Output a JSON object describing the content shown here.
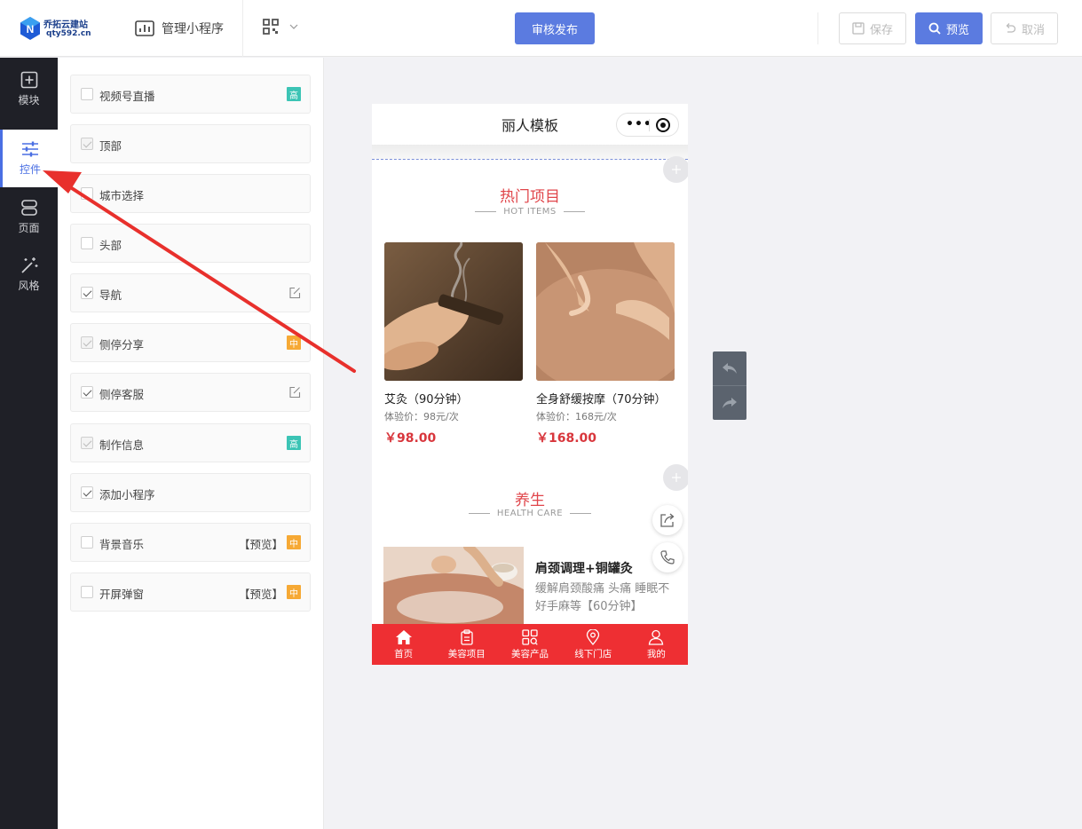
{
  "topbar": {
    "logo_text": "乔拓云建站",
    "logo_domain": "qty592.cn",
    "manage_label": "管理小程序",
    "publish_label": "审核发布",
    "save_label": "保存",
    "preview_label": "预览",
    "cancel_label": "取消"
  },
  "sidebar": {
    "items": [
      {
        "label": "模块",
        "icon": "plus-square-icon"
      },
      {
        "label": "控件",
        "icon": "sliders-icon",
        "active": true
      },
      {
        "label": "页面",
        "icon": "pages-icon"
      },
      {
        "label": "风格",
        "icon": "magic-wand-icon"
      }
    ]
  },
  "controls": {
    "preview_tag": "【预览】",
    "badge_high": "高",
    "badge_mid": "中",
    "items": [
      {
        "label": "视频号直播",
        "state": "unchecked",
        "badge": "高"
      },
      {
        "label": "顶部",
        "state": "checked-disabled"
      },
      {
        "label": "城市选择",
        "state": "unchecked"
      },
      {
        "label": "头部",
        "state": "unchecked"
      },
      {
        "label": "导航",
        "state": "checked",
        "edit": true
      },
      {
        "label": "侧停分享",
        "state": "checked-disabled",
        "badge": "中"
      },
      {
        "label": "侧停客服",
        "state": "checked",
        "edit": true
      },
      {
        "label": "制作信息",
        "state": "checked-disabled",
        "badge": "高"
      },
      {
        "label": "添加小程序",
        "state": "checked"
      },
      {
        "label": "背景音乐",
        "state": "unchecked",
        "preview": true,
        "badge": "中"
      },
      {
        "label": "开屏弹窗",
        "state": "unchecked",
        "preview": true,
        "badge": "中"
      }
    ]
  },
  "phone": {
    "title": "丽人模板",
    "hot": {
      "title": "热门项目",
      "subtitle": "HOT ITEMS",
      "products": [
        {
          "name": "艾灸（90分钟）",
          "exp": "体验价：98元/次",
          "price": "￥98.00"
        },
        {
          "name": "全身舒缓按摩（70分钟）",
          "exp": "体验价：168元/次",
          "price": "￥168.00"
        }
      ]
    },
    "health": {
      "title": "养生",
      "subtitle": "HEALTH CARE",
      "item_name": "肩颈调理+铜罐灸",
      "item_desc": "缓解肩颈酸痛 头痛 睡眠不好手麻等【60分钟】"
    },
    "tabs": [
      {
        "label": "首页",
        "icon": "home-icon"
      },
      {
        "label": "美容项目",
        "icon": "clipboard-icon"
      },
      {
        "label": "美容产品",
        "icon": "grid-search-icon"
      },
      {
        "label": "线下门店",
        "icon": "location-pin-icon"
      },
      {
        "label": "我的",
        "icon": "user-icon"
      }
    ]
  },
  "colors": {
    "accent": "#5b7be0",
    "tabbar": "#ee2f33",
    "section_title": "#e0464b",
    "price": "#d8363c",
    "sidebar_bg": "#1f2027",
    "annotation_arrow": "#e8302c"
  }
}
